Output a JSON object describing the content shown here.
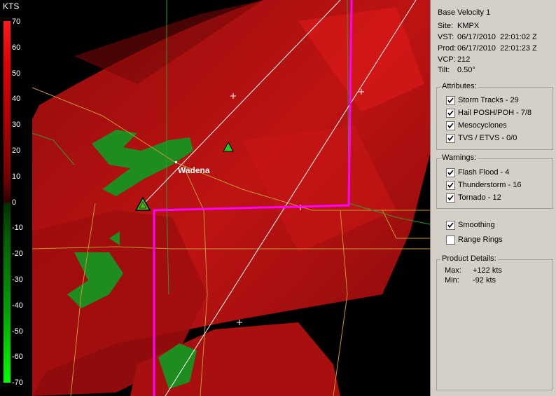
{
  "legend": {
    "unit": "KTS",
    "ticks": [
      "70",
      "60",
      "50",
      "40",
      "30",
      "20",
      "10",
      "0",
      "-10",
      "-20",
      "-30",
      "-40",
      "-50",
      "-60",
      "-70"
    ]
  },
  "map": {
    "city_label": "Wadena"
  },
  "panel": {
    "product": "Base Velocity 1",
    "site_label": "Site:",
    "site": "KMPX",
    "vst_label": "VST:",
    "vst": "06/17/2010  22:01:02 Z",
    "prod_label": "Prod:",
    "prod": "06/17/2010  22:01:23 Z",
    "vcp_label": "VCP:",
    "vcp": "212",
    "tilt_label": "Tilt:",
    "tilt": "0.50°",
    "attributes_title": "Attributes:",
    "attributes": [
      {
        "label": "Storm Tracks - 29",
        "checked": true
      },
      {
        "label": "Hail POSH/POH - 7/8",
        "checked": true
      },
      {
        "label": "Mesocyclones",
        "checked": true
      },
      {
        "label": "TVS / ETVS - 0/0",
        "checked": true
      }
    ],
    "warnings_title": "Warnings:",
    "warnings": [
      {
        "label": "Flash Flood - 4",
        "checked": true
      },
      {
        "label": "Thunderstorm - 16",
        "checked": true
      },
      {
        "label": "Tornado - 12",
        "checked": true
      }
    ],
    "smoothing_label": "Smoothing",
    "smoothing_checked": true,
    "range_rings_label": "Range Rings",
    "range_rings_checked": false,
    "details_title": "Product Details:",
    "max_label": "Max:",
    "max": "+122 kts",
    "min_label": "Min:",
    "min": "-92 kts"
  },
  "colors": {
    "county_line": "#c89632",
    "warning_box": "#ff00ff",
    "storm_green": "#1e8c1e",
    "radar_red": "#b40f0f"
  }
}
